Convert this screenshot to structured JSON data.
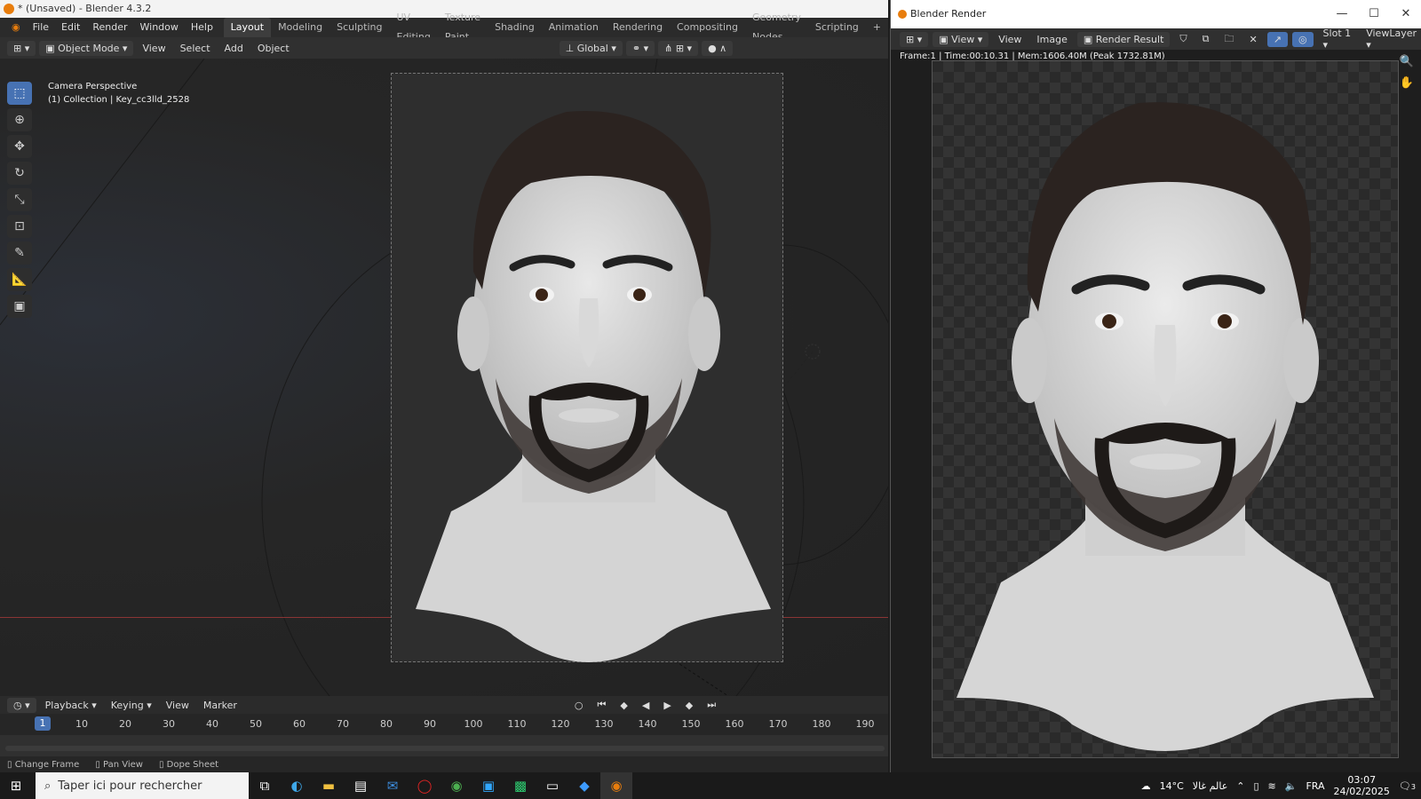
{
  "app": {
    "title": "* (Unsaved) - Blender 4.3.2"
  },
  "menu": [
    "File",
    "Edit",
    "Render",
    "Window",
    "Help"
  ],
  "workspaces": [
    "Layout",
    "Modeling",
    "Sculpting",
    "UV Editing",
    "Texture Paint",
    "Shading",
    "Animation",
    "Rendering",
    "Compositing",
    "Geometry Nodes",
    "Scripting",
    "+"
  ],
  "active_workspace": "Layout",
  "viewport_header": {
    "mode": "Object Mode",
    "view": "View",
    "select": "Select",
    "add": "Add",
    "object": "Object",
    "orientation": "Global"
  },
  "viewport": {
    "line1": "Camera Perspective",
    "line2": "(1) Collection | Key_cc3lld_2528"
  },
  "toolbar": [
    "select-box-icon",
    "cursor-icon",
    "move-icon",
    "rotate-icon",
    "scale-icon",
    "transform-icon",
    "annotate-icon",
    "measure-icon",
    "add-cube-icon"
  ],
  "timeline": {
    "playback": "Playback",
    "keying": "Keying",
    "view": "View",
    "marker": "Marker",
    "current_frame": "1",
    "ticks": [
      "10",
      "20",
      "30",
      "40",
      "50",
      "60",
      "70",
      "80",
      "90",
      "100",
      "110",
      "120",
      "130",
      "140",
      "150",
      "160",
      "170",
      "180",
      "190"
    ]
  },
  "status": {
    "change_frame": "Change Frame",
    "pan_view": "Pan View",
    "dope_sheet": "Dope Sheet"
  },
  "render_window": {
    "title": "Blender Render",
    "view1": "View",
    "view2": "View",
    "image": "Image",
    "result": "Render Result",
    "slot": "Slot 1",
    "layer": "ViewLayer",
    "info": "Frame:1 | Time:00:10.31 | Mem:1606.40M (Peak 1732.81M)"
  },
  "taskbar": {
    "search_placeholder": "Taper ici pour rechercher",
    "weather": "14°C",
    "weather_text": "عالم غالا",
    "lang": "FRA",
    "time": "03:07",
    "date": "24/02/2025",
    "notif": "3"
  }
}
